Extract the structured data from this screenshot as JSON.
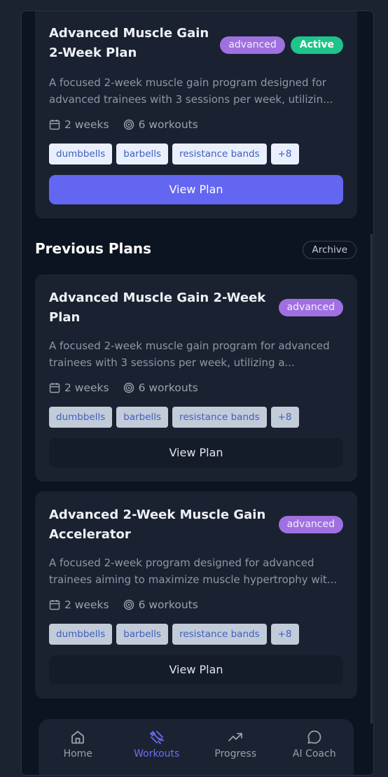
{
  "active_plan": {
    "title_lines": [
      "Advanced Muscle Gain",
      "2-Week Plan"
    ],
    "level_badge": "advanced",
    "status_badge": "Active",
    "description_lines": [
      "A focused 2-week muscle gain program designed for",
      "advanced trainees with 3 sessions per week, utilizin..."
    ],
    "duration": "2 weeks",
    "workouts": "6 workouts",
    "tags": [
      "dumbbells",
      "barbells",
      "resistance bands",
      "+8"
    ],
    "button_label": "View Plan"
  },
  "previous_section": {
    "title": "Previous Plans",
    "archive_label": "Archive"
  },
  "previous_plans": [
    {
      "title_lines": [
        "Advanced Muscle Gain 2-Week",
        "Plan"
      ],
      "level_badge": "advanced",
      "description_lines": [
        "A focused 2-week muscle gain program for advanced",
        "trainees with 3 sessions per week, utilizing a..."
      ],
      "duration": "2 weeks",
      "workouts": "6 workouts",
      "tags": [
        "dumbbells",
        "barbells",
        "resistance bands",
        "+8"
      ],
      "button_label": "View Plan"
    },
    {
      "title_lines": [
        "Advanced 2-Week Muscle Gain",
        "Accelerator"
      ],
      "level_badge": "advanced",
      "description_lines": [
        "A focused 2-week program designed for advanced",
        "trainees aiming to maximize muscle hypertrophy wit..."
      ],
      "duration": "2 weeks",
      "workouts": "6 workouts",
      "tags": [
        "dumbbells",
        "barbells",
        "resistance bands",
        "+8"
      ],
      "button_label": "View Plan"
    }
  ],
  "bottom_nav": {
    "items": [
      {
        "label": "Home",
        "icon": "home-icon"
      },
      {
        "label": "Workouts",
        "icon": "workouts-icon",
        "active": true
      },
      {
        "label": "Progress",
        "icon": "trend-up-icon"
      },
      {
        "label": "AI Coach",
        "icon": "chat-bubble-icon"
      }
    ]
  },
  "colors": {
    "accent": "#6366f1",
    "active_badge": "#1ec489",
    "level_badge": "#a070e0"
  }
}
